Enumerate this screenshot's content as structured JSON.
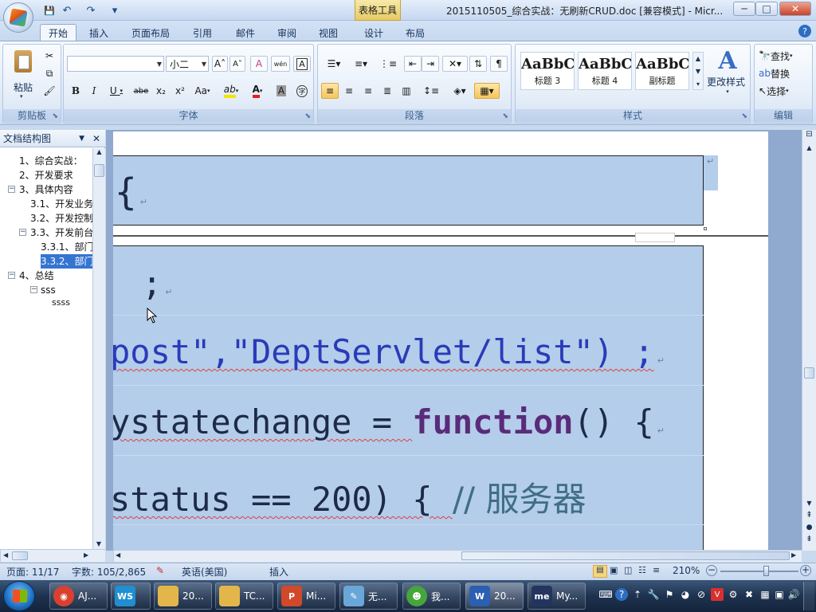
{
  "titlebar": {
    "context_tab": "表格工具",
    "title": "2015110505_综合实战：无刷新CRUD.doc [兼容模式] - Micr...",
    "qat_save": "💾",
    "qat_undo": "↶",
    "qat_redo": "↷",
    "qat_more": "▾",
    "minimize": "─",
    "maximize": "□",
    "close": "✕"
  },
  "tabs": [
    {
      "label": "开始",
      "active": true
    },
    {
      "label": "插入"
    },
    {
      "label": "页面布局"
    },
    {
      "label": "引用"
    },
    {
      "label": "邮件"
    },
    {
      "label": "审阅"
    },
    {
      "label": "视图"
    },
    {
      "label": "设计"
    },
    {
      "label": "布局"
    }
  ],
  "help": "?",
  "ribbon": {
    "clipboard": {
      "title": "剪贴板",
      "paste": "粘贴"
    },
    "font": {
      "title": "字体",
      "font_name": "",
      "font_size": "小二",
      "grow": "A˄",
      "shrink": "A˅",
      "clear": "A",
      "phonetic": "wén",
      "border_char": "A",
      "bold": "B",
      "italic": "I",
      "underline": "U",
      "strike": "abe",
      "subscript": "x₂",
      "superscript": "x²",
      "case": "Aa",
      "highlight": "ab",
      "font_color": "A",
      "shade_char": "A",
      "enclose": "字"
    },
    "paragraph": {
      "title": "段落"
    },
    "styles": {
      "title": "样式",
      "items": [
        {
          "sample": "AaBbC",
          "name": "标题 3"
        },
        {
          "sample": "AaBbC",
          "name": "标题 4"
        },
        {
          "sample": "AaBbC",
          "name": "副标题"
        }
      ],
      "change_styles": "更改样式"
    },
    "editing": {
      "title": "编辑",
      "find": "查找",
      "replace": "替换",
      "select": "选择"
    }
  },
  "nav": {
    "title": "文档结构图",
    "close": "✕",
    "items": [
      {
        "label": "1、综合实战："
      },
      {
        "label": "2、开发要求"
      },
      {
        "label": "3、具体内容"
      },
      {
        "label": "3.1、开发业务"
      },
      {
        "label": "3.2、开发控制"
      },
      {
        "label": "3.3、开发前台"
      },
      {
        "label": "3.3.1、部门"
      },
      {
        "label": "3.3.2、部门",
        "selected": true
      },
      {
        "label": "4、总结"
      },
      {
        "label": "sss"
      },
      {
        "label": "ssss"
      }
    ],
    "toggle_minus": "−"
  },
  "document": {
    "cell1_brace": "{",
    "line_semicolon": ";",
    "line_open_post": "post\",\"DeptServlet/list\") ;",
    "line_state_a": "ystatechange = ",
    "line_state_kw": "function",
    "line_state_b": "() {",
    "line_status": "status == 200) { ",
    "line_status_comment": "// 服务器",
    "para_mark": "↵"
  },
  "status": {
    "page": "页面: 11/17",
    "words": "字数: 105/2,865",
    "language": "英语(美国)",
    "insert_mode": "插入",
    "zoom": "210%"
  },
  "taskbar": {
    "items": [
      {
        "label": "AJ...",
        "icon": "chrome-icon",
        "color": "#d9412e"
      },
      {
        "label": "",
        "icon": "webstorm-icon",
        "color": "#1f8fd1"
      },
      {
        "label": "20...",
        "icon": "folder-icon",
        "color": "#e2b64a"
      },
      {
        "label": "TC...",
        "icon": "folder-icon",
        "color": "#e2b64a"
      },
      {
        "label": "Mi...",
        "icon": "powerpoint-icon",
        "color": "#d2482a"
      },
      {
        "label": "无...",
        "icon": "notepad-icon",
        "color": "#6aa7d9"
      },
      {
        "label": "我...",
        "icon": "chat-icon",
        "color": "#45a63c"
      },
      {
        "label": "20...",
        "icon": "word-icon",
        "color": "#2a5fb1",
        "active": true
      },
      {
        "label": "My...",
        "icon": "myeclipse-icon",
        "color": "#23345e"
      }
    ]
  }
}
